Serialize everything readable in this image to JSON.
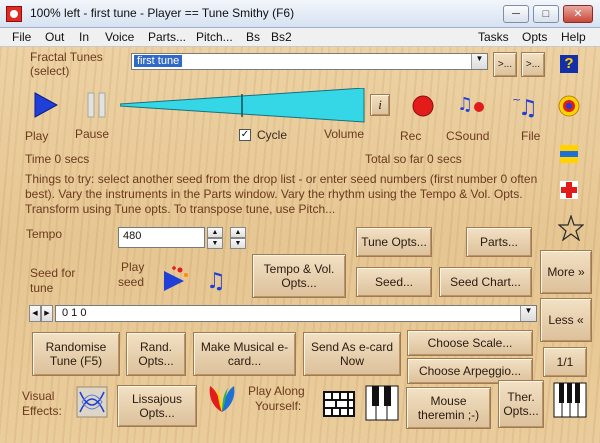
{
  "window": {
    "title": "100% left - first tune - Player == Tune Smithy (F6)",
    "minimize": "─",
    "maximize": "□",
    "close": "✕"
  },
  "menu": {
    "items": [
      "File",
      "Out",
      "In",
      "Voice",
      "Parts...",
      "Pitch...",
      "Bs",
      "Bs2"
    ],
    "right_items": [
      "Tasks",
      "Opts",
      "Help"
    ]
  },
  "fractal": {
    "label_line1": "Fractal Tunes",
    "label_line2": "(select)",
    "selected": "first tune",
    "prev": ">...",
    "next": ">..."
  },
  "transport": {
    "play_label": "Play",
    "pause_label": "Pause",
    "cycle_label": "Cycle",
    "cycle_checked": true,
    "volume_label": "Volume",
    "volume_level": "0.88",
    "rec_label": "Rec",
    "csound_label": "CSound",
    "file_label": "File",
    "info_button": "i"
  },
  "status": {
    "time": "Time 0 secs",
    "total": "Total so far 0 secs"
  },
  "help_text": "Things to try: select another seed from the drop list - or enter seed numbers (first number 0 often best). Vary the instruments in the Parts window. Vary the rhythm using the Tempo & Vol. Opts. Transform using Tune opts. To transpose tune, use Pitch...",
  "tempo": {
    "label": "Tempo",
    "value": "480"
  },
  "seed": {
    "label_line1": "Seed for",
    "label_line2": "tune",
    "play_label_line1": "Play",
    "play_label_line2": "seed",
    "value": "0 1 0"
  },
  "buttons": {
    "tune_opts": "Tune Opts...",
    "parts": "Parts...",
    "tempo_vol": "Tempo & Vol. Opts...",
    "seed": "Seed...",
    "seed_chart": "Seed Chart...",
    "more": "More »",
    "less": "Less «",
    "randomise": "Randomise Tune (F5)",
    "rand_opts": "Rand. Opts...",
    "make_musical": "Make Musical e-card...",
    "send_ecard": "Send As e-card Now",
    "choose_scale": "Choose Scale...",
    "choose_arpeggio": "Choose Arpeggio...",
    "page": "1/1",
    "lissajous": "Lissajous Opts...",
    "mouse_theremin": "Mouse theremin ;-)",
    "ther_opts": "Ther. Opts..."
  },
  "bottom": {
    "visual_line1": "Visual",
    "visual_line2": "Effects:",
    "play_along_line1": "Play Along",
    "play_along_line2": "Yourself:"
  },
  "side": {
    "help_icon": "?"
  },
  "colors": {
    "accent_blue": "#1f3fd6",
    "volume_cyan": "#35d7e6",
    "rec_red": "#e21b1b",
    "text_brown": "#6b3a1f"
  }
}
